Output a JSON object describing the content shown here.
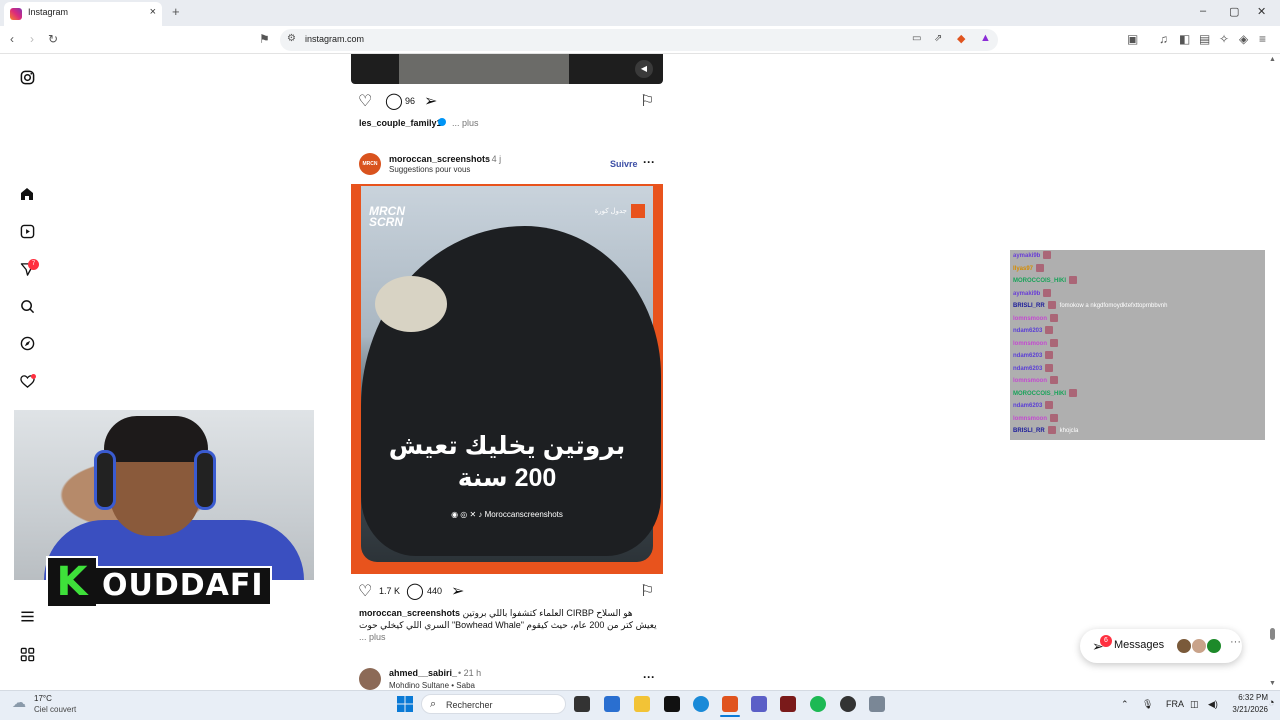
{
  "browser": {
    "tab_title": "Instagram",
    "tab_close": "×",
    "new_tab": "+",
    "url": "instagram.com",
    "window_controls": [
      "–",
      "▢",
      "✕"
    ]
  },
  "sidebar": {
    "notifications_badge": "7",
    "icons": [
      "instagram-icon",
      "home-icon",
      "reels-icon",
      "send-icon",
      "search-icon",
      "explore-icon",
      "heart-icon",
      "menu-icon",
      "apps-icon"
    ]
  },
  "webcam": {
    "logo_letter": "K",
    "logo_name": "OUDDAFI"
  },
  "prev_post": {
    "comments": "96",
    "username": "les_couple_family1",
    "more": "... plus"
  },
  "post": {
    "username": "moroccan_screenshots",
    "time": "• 4 j",
    "subtitle": "Suggestions pour vous",
    "follow": "Suivre",
    "avatar_text": "MRCN SCRN",
    "brand": "MRCN\nSCRN",
    "corner_text": "جدول كورة",
    "headline_line1": "بروتين يخليك تعيش",
    "headline_line2": "200 سنة",
    "social_handle": "Moroccanscreenshots",
    "likes": "1.7 K",
    "comments": "440",
    "caption_user": "moroccan_screenshots",
    "caption_text": "العلماء كتشفوا باللي بروتين CIRBP هو السلاح السري اللي كيخلي حوت \"Bowhead Whale\" يعيش كتر من 200 عام، حيث كيقوم",
    "caption_more": "... plus"
  },
  "next_post": {
    "username": "ahmed__sabiri_",
    "time": "• 21 h",
    "subtitle": "Mohdino Sultane • Saba"
  },
  "chat": {
    "lines": [
      {
        "name": "aymaki9b",
        "color": "#6a3fd6",
        "msg": ""
      },
      {
        "name": "Ilyas97",
        "color": "#d58b00",
        "msg": ""
      },
      {
        "name": "MOROCCOIS_HIKI",
        "color": "#1aa35a",
        "msg": ""
      },
      {
        "name": "aymaki9b",
        "color": "#6a3fd6",
        "msg": ""
      },
      {
        "name": "BRISLI_RR",
        "color": "#1b1b9a",
        "msg": "fomokow a nkgdfomoydktefxttoprnbbvnh"
      },
      {
        "name": "lomnsmoon",
        "color": "#c44ad1",
        "msg": ""
      },
      {
        "name": "ndam6203",
        "color": "#5b3fd6",
        "msg": ""
      },
      {
        "name": "lomnsmoon",
        "color": "#c44ad1",
        "msg": ""
      },
      {
        "name": "ndam6203",
        "color": "#5b3fd6",
        "msg": ""
      },
      {
        "name": "ndam6203",
        "color": "#5b3fd6",
        "msg": ""
      },
      {
        "name": "lomnsmoon",
        "color": "#c44ad1",
        "msg": ""
      },
      {
        "name": "MOROCCOIS_HIKI",
        "color": "#1aa35a",
        "msg": ""
      },
      {
        "name": "ndam6203",
        "color": "#5b3fd6",
        "msg": ""
      },
      {
        "name": "lomnsmoon",
        "color": "#c44ad1",
        "msg": ""
      },
      {
        "name": "BRISLI_RR",
        "color": "#1b1b9a",
        "msg": "khojcla"
      }
    ]
  },
  "messages": {
    "badge": "6",
    "label": "Messages",
    "more": "···"
  },
  "taskbar": {
    "weather_temp": "17°C",
    "weather_desc": "Ciel couvert",
    "search_label": "Rechercher",
    "lang": "FRA",
    "time": "6:32 PM",
    "date": "3/21/2026"
  },
  "colors": {
    "accent_blue": "#0095f6",
    "follow_blue": "#3d4fa6",
    "badge_red": "#ff3040",
    "post_orange": "#e8531d"
  }
}
